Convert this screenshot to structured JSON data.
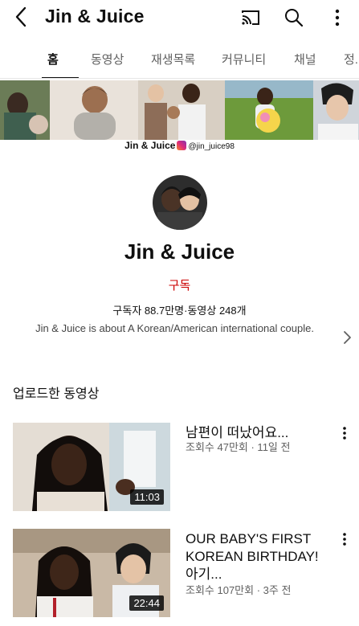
{
  "header": {
    "title": "Jin & Juice",
    "back_icon": "arrow-back-icon",
    "cast_icon": "cast-icon",
    "search_icon": "search-icon",
    "more_icon": "more-vertical-icon"
  },
  "tabs": [
    {
      "label": "홈",
      "active": true
    },
    {
      "label": "동영상"
    },
    {
      "label": "재생목록"
    },
    {
      "label": "커뮤니티"
    },
    {
      "label": "채널"
    },
    {
      "label": "정."
    }
  ],
  "banner": {
    "name": "Jin & Juice",
    "handle": "@jin_juice98"
  },
  "channel": {
    "name": "Jin & Juice",
    "subscribe_label": "구독",
    "stats": "구독자 88.7만명·동영상 248개",
    "description": "Jin & Juice is about A Korean/American international couple."
  },
  "uploads": {
    "heading": "업로드한 동영상",
    "videos": [
      {
        "title": "남편이 떠났어요...",
        "meta": "조회수 47만회 · 11일 전",
        "duration": "11:03"
      },
      {
        "title": "OUR BABY'S FIRST KOREAN BIRTHDAY! 아기...",
        "meta": "조회수 107만회 · 3주 전",
        "duration": "22:44"
      }
    ]
  },
  "colors": {
    "subscribe": "#cc0000",
    "text": "#0f0f0f",
    "secondary": "#606060"
  }
}
